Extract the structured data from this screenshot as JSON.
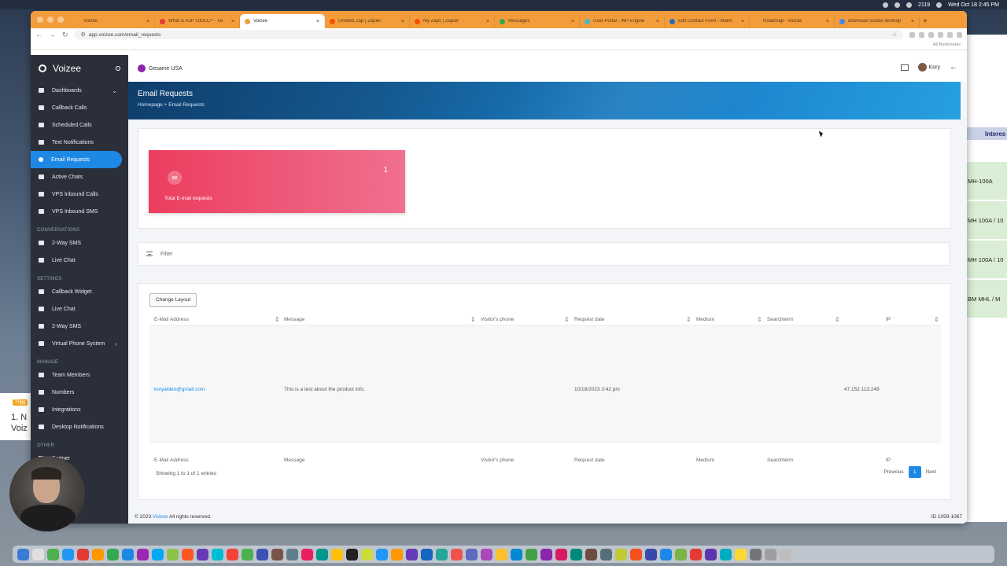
{
  "mac_menubar": {
    "clock": "Wed Oct 18  2:45 PM",
    "battery": "2119"
  },
  "browser": {
    "tabs": [
      {
        "title": "Voizee",
        "active": false,
        "color": "#f39c3c"
      },
      {
        "title": "What is A2P 10DLC? - Tw",
        "active": false,
        "color": "#e53935"
      },
      {
        "title": "Voizee",
        "active": true,
        "color": "#f39c3c"
      },
      {
        "title": "Untitled Zap | Zapier",
        "active": false,
        "color": "#ff4a00"
      },
      {
        "title": "My Zaps | Zapier",
        "active": false,
        "color": "#ff4a00"
      },
      {
        "title": "Messages",
        "active": false,
        "color": "#34a853"
      },
      {
        "title": "User Portal - WP Engine",
        "active": false,
        "color": "#40bac8"
      },
      {
        "title": "Edit Contact Form ‹ Mainl",
        "active": false,
        "color": "#2271b1"
      },
      {
        "title": "Roadmap - Voizee",
        "active": false,
        "color": "#f39c3c"
      },
      {
        "title": "download voizee desktop",
        "active": false,
        "color": "#4285f4"
      }
    ],
    "url": "app.voizee.com/email_requests",
    "bookmarks_label": "All Bookmarks"
  },
  "sidebar": {
    "brand": "Voizee",
    "items": [
      {
        "label": "Dashboards",
        "chevron": "⌄"
      },
      {
        "label": "Callback Calls"
      },
      {
        "label": "Scheduled Calls"
      },
      {
        "label": "Text Notifications"
      },
      {
        "label": "Email Requests",
        "active": true
      },
      {
        "label": "Active Chats"
      },
      {
        "label": "VPS Inbound Calls"
      },
      {
        "label": "VPS Inbound SMS"
      }
    ],
    "sections": {
      "conversations": {
        "title": "CONVERSATIONS",
        "items": [
          "2-Way SMS",
          "Live Chat"
        ]
      },
      "settings": {
        "title": "SETTINGS",
        "items": [
          "Callback Widget",
          "Live Chat",
          "2-Way SMS",
          "Virtual Phone System"
        ]
      },
      "manage": {
        "title": "MANAGE",
        "items": [
          "Team Members",
          "Numbers",
          "Integrations",
          "Desktop Notifications"
        ]
      },
      "other": {
        "title": "OTHER",
        "items": [
          "Partner"
        ]
      }
    }
  },
  "topbar": {
    "org": "Gesame USA",
    "user": "Kory"
  },
  "banner": {
    "title": "Email Requests",
    "crumb_home": "Homepage",
    "crumb_current": "Email Requests"
  },
  "stat_card": {
    "value": "1",
    "label": "Total E-mail requests",
    "color": "#ec3d5f"
  },
  "filter": {
    "label": "Filter"
  },
  "table": {
    "change_layout": "Change Layout",
    "columns": [
      "E-Mail Address",
      "Message",
      "Visitor's phone",
      "Request date",
      "Medium",
      "Searchterm",
      "IP"
    ],
    "rows": [
      [
        "koryalden@gmail.com",
        "This is a test about the product info.",
        "",
        "10/18/2023 3:42 pm",
        "",
        "",
        "47.152.113.249"
      ]
    ],
    "showing": "Showing 1 to 1 of 1 entries",
    "pager": {
      "prev": "Previous",
      "current": "1",
      "next": "Next"
    }
  },
  "footer": {
    "copyright": "© 2023",
    "brand": "Voizee",
    "rights": "All rights reserved.",
    "id": "ID 1059-1067"
  },
  "background_window": {
    "header": "Interes",
    "cells": [
      "MH-100A",
      "MH 100A / 10",
      "MH 100A / 10",
      "BM MHL / M"
    ]
  },
  "background_left": {
    "badge": "Trigg",
    "text_line1": "1. N",
    "text_line2": "Voiz"
  },
  "dock": {
    "icon_count": 52
  }
}
